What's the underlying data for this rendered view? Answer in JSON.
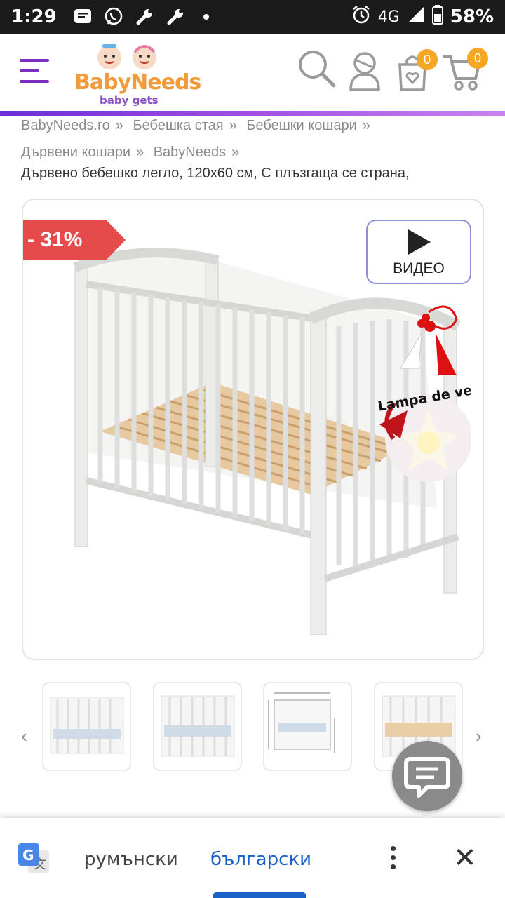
{
  "status_bar": {
    "time": "1:29",
    "network": "4G",
    "battery": "58%"
  },
  "header": {
    "logo_text_main": "BabyNeeds",
    "logo_text_sub": "baby gets",
    "wishlist_count": "0",
    "cart_count": "0"
  },
  "breadcrumb": {
    "items": [
      "BabyNeeds.ro",
      "Бебешка стая",
      "Бебешки кошари",
      "Дървени кошари",
      "BabyNeeds"
    ],
    "separator": "»"
  },
  "product": {
    "title": "Дървено бебешко легло, 120x60 см, С плъзгаща се страна,",
    "discount": "- 31%",
    "video_label": "ВИДЕО",
    "promo_text": "Lampa de veghe cadou"
  },
  "thumbnails": {
    "prev_arrow": "‹",
    "next_arrow": "›"
  },
  "translate_bar": {
    "source_language": "румънски",
    "target_language": "български"
  },
  "colors": {
    "accent_purple": "#7b2fbf",
    "badge_orange": "#f6a623",
    "discount_red": "#e64b4b",
    "translate_blue": "#1a62c7"
  }
}
